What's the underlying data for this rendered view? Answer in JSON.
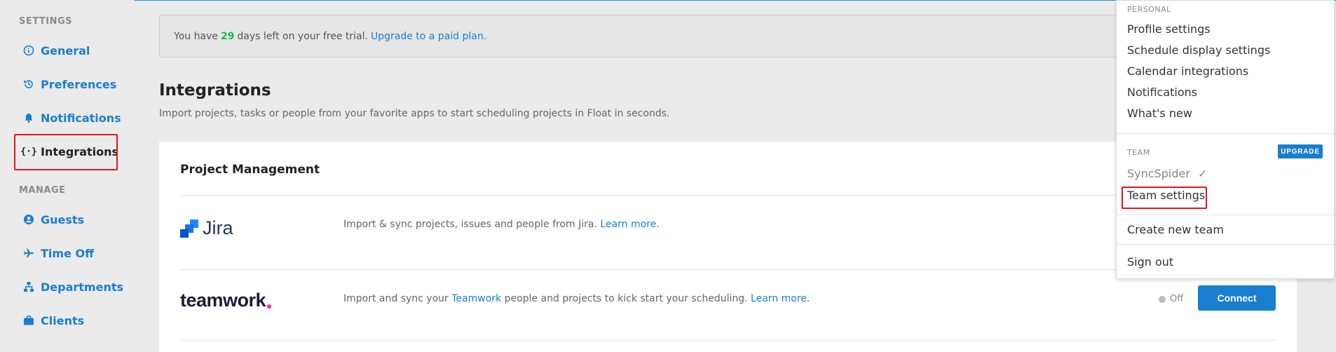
{
  "sidebar": {
    "settings_title": "SETTINGS",
    "manage_title": "MANAGE",
    "settings_items": [
      {
        "label": "General",
        "icon": "info-icon"
      },
      {
        "label": "Preferences",
        "icon": "history-icon"
      },
      {
        "label": "Notifications",
        "icon": "bell-icon"
      },
      {
        "label": "Integrations",
        "icon": "braces-icon"
      }
    ],
    "manage_items": [
      {
        "label": "Guests",
        "icon": "user-circle-icon"
      },
      {
        "label": "Time Off",
        "icon": "plane-icon"
      },
      {
        "label": "Departments",
        "icon": "org-chart-icon"
      },
      {
        "label": "Clients",
        "icon": "briefcase-icon"
      }
    ]
  },
  "trial": {
    "prefix": "You have",
    "days": "29",
    "suffix": "days left on your free trial.",
    "link": "Upgrade to a paid plan."
  },
  "page": {
    "title": "Integrations",
    "subtitle": "Import projects, tasks or people from your favorite apps to start scheduling projects in Float in seconds."
  },
  "card": {
    "title": "Project Management",
    "rows": [
      {
        "logo": "Jira",
        "desc": "Import & sync projects, issues and people from Jira.",
        "link": "Learn more."
      },
      {
        "logo": "teamwork",
        "desc_pre": "Import and sync your",
        "desc_link": "Teamwork",
        "desc_post": "people and projects to kick start your scheduling.",
        "link": "Learn more.",
        "status": "Off",
        "button": "Connect"
      }
    ]
  },
  "dropdown": {
    "personal_title": "PERSONAL",
    "personal_items": [
      "Profile settings",
      "Schedule display settings",
      "Calendar integrations",
      "Notifications",
      "What's new"
    ],
    "team_title": "TEAM",
    "upgrade": "UPGRADE",
    "team_name": "SyncSpider",
    "team_settings": "Team settings",
    "create_team": "Create new team",
    "sign_out": "Sign out"
  },
  "colors": {
    "accent": "#1a7ed0",
    "highlight": "#e8131b",
    "trial_days": "#1db954",
    "teamwork_dot": "#ff22b1"
  }
}
